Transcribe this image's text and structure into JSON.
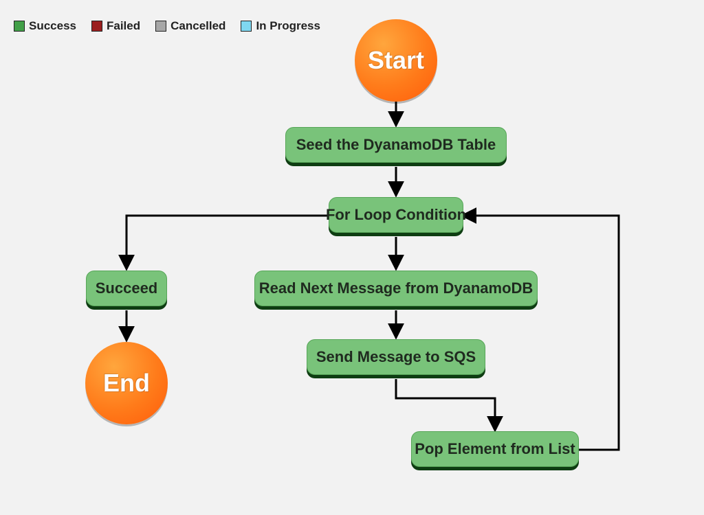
{
  "legend": {
    "success": "Success",
    "failed": "Failed",
    "cancelled": "Cancelled",
    "inprogress": "In Progress"
  },
  "nodes": {
    "start": "Start",
    "end": "End",
    "seed": "Seed the DyanamoDB Table",
    "loop": "For Loop Condition",
    "succeed": "Succeed",
    "read": "Read Next Message from DyanamoDB",
    "send": "Send Message to SQS",
    "pop": "Pop Element from List"
  },
  "colors": {
    "success": "#42a048",
    "failed": "#9b2020",
    "cancelled": "#a7a7a7",
    "inprogress": "#7fd7f0",
    "node_fill": "#79c37a",
    "circle_orange": "#ff7b1a"
  },
  "flow_edges": [
    [
      "start",
      "seed"
    ],
    [
      "seed",
      "loop"
    ],
    [
      "loop",
      "succeed"
    ],
    [
      "loop",
      "read"
    ],
    [
      "read",
      "send"
    ],
    [
      "send",
      "pop"
    ],
    [
      "pop",
      "loop"
    ],
    [
      "succeed",
      "end"
    ]
  ]
}
